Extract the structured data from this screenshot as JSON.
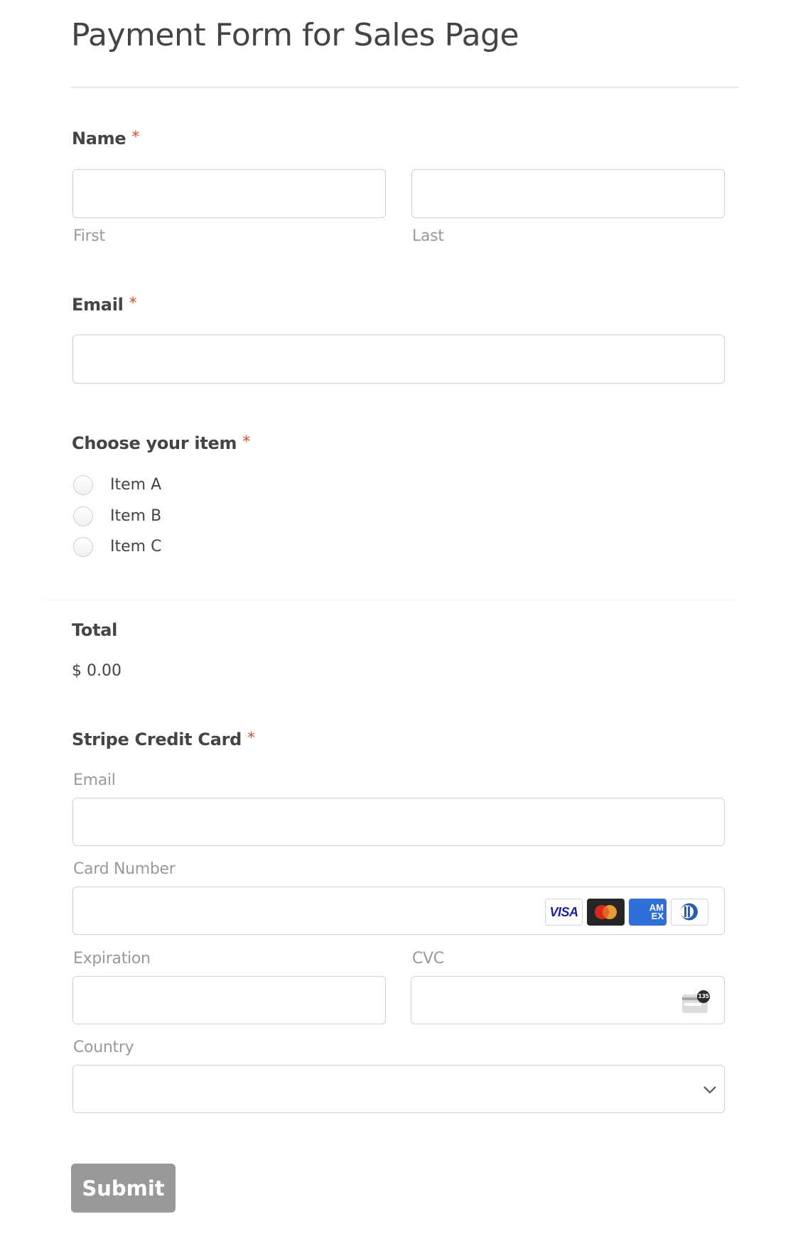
{
  "form": {
    "title": "Payment Form for Sales Page",
    "required_marker": "*",
    "name": {
      "label": "Name",
      "first_value": "",
      "last_value": "",
      "first_sublabel": "First",
      "last_sublabel": "Last"
    },
    "email": {
      "label": "Email",
      "value": ""
    },
    "item_choice": {
      "label": "Choose your item",
      "options": [
        {
          "label": "Item A",
          "checked": false
        },
        {
          "label": "Item B",
          "checked": false
        },
        {
          "label": "Item C",
          "checked": false
        }
      ]
    },
    "total": {
      "label": "Total",
      "value": "$ 0.00"
    },
    "stripe": {
      "label": "Stripe Credit Card",
      "email_label": "Email",
      "email_value": "",
      "card_number_label": "Card Number",
      "card_number_value": "",
      "card_brands": [
        "visa",
        "mastercard",
        "amex",
        "diners"
      ],
      "visa_text": "VISA",
      "amex_text": "AM EX",
      "expiration_label": "Expiration",
      "expiration_value": "",
      "cvc_label": "CVC",
      "cvc_value": "",
      "cvc_icon_text": "135",
      "country_label": "Country",
      "country_selected": ""
    },
    "submit_label": "Submit"
  },
  "colors": {
    "required": "#d0502f",
    "submit_bg": "#999999",
    "amex_blue": "#2e6fd9",
    "visa_blue": "#1a1f9e"
  }
}
